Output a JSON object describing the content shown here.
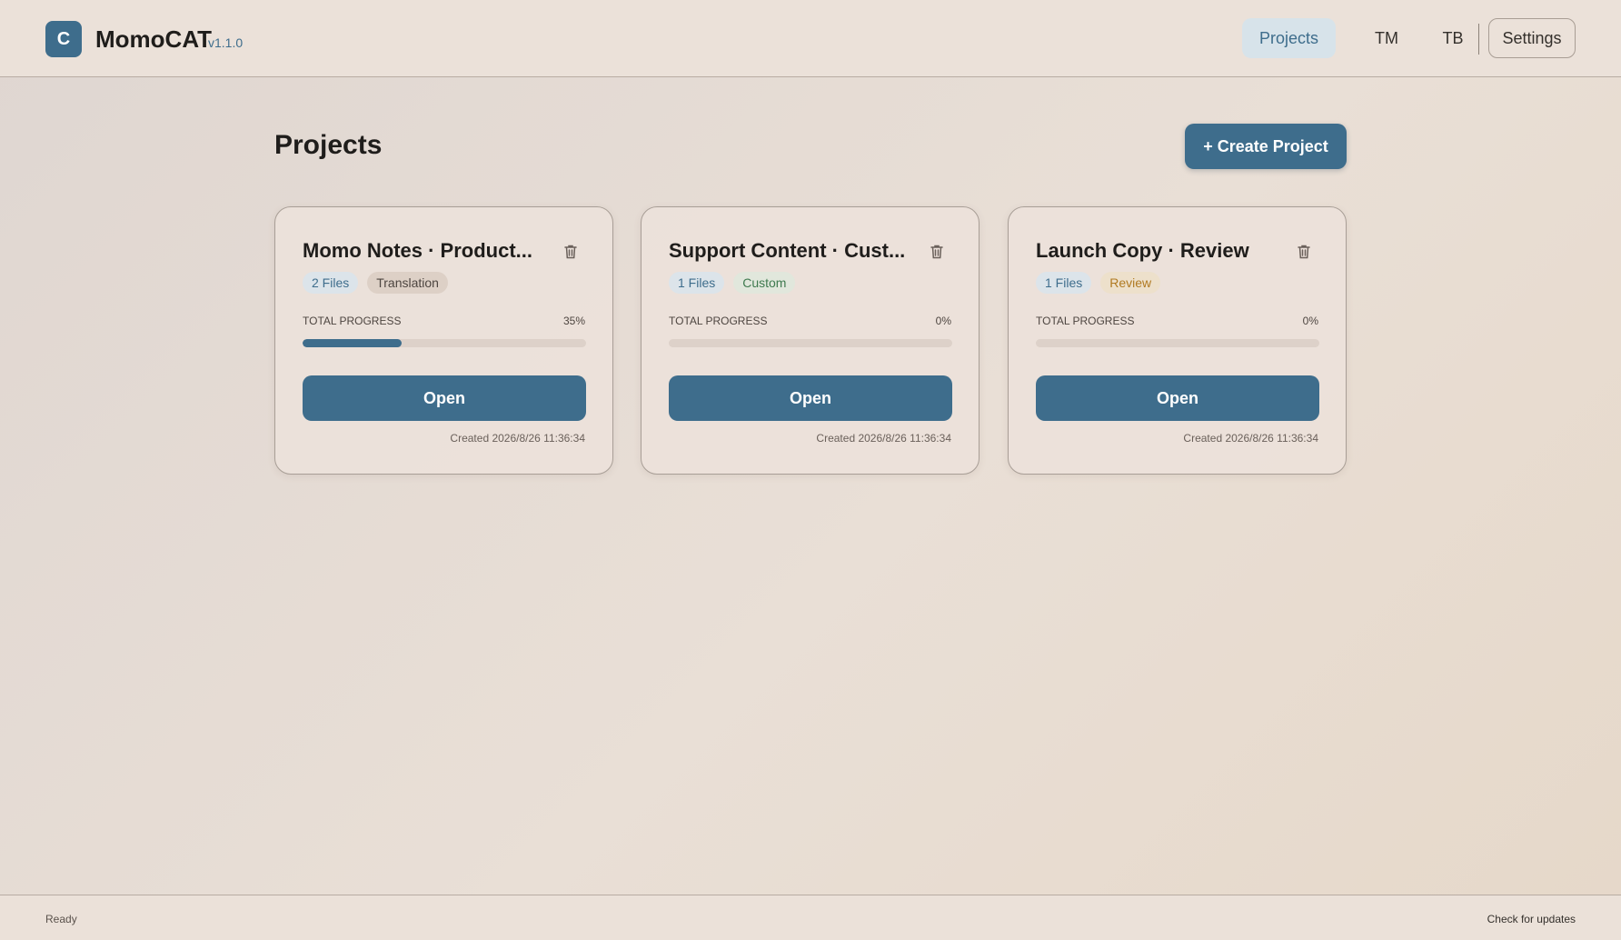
{
  "header": {
    "logo_letter": "C",
    "app_name": "MomoCAT",
    "version": "v1.1.0",
    "nav": {
      "projects": "Projects",
      "tm": "TM",
      "tb": "TB",
      "settings": "Settings"
    },
    "active_nav": "Projects"
  },
  "main": {
    "title": "Projects",
    "create_button": "+ Create Project",
    "progress_label": "TOTAL PROGRESS",
    "open_label": "Open",
    "projects": [
      {
        "title": "Momo Notes · Product...",
        "files": "2 Files",
        "type": "Translation",
        "progress_text": "35%",
        "progress": 0.35,
        "created": "Created 2026/8/26 11:36:34"
      },
      {
        "title": "Support Content · Cust...",
        "files": "1 Files",
        "type": "Custom",
        "progress_text": "0%",
        "progress": 0,
        "created": "Created 2026/8/26 11:36:34"
      },
      {
        "title": "Launch Copy · Review",
        "files": "1 Files",
        "type": "Review",
        "progress_text": "0%",
        "progress": 0,
        "created": "Created 2026/8/26 11:36:34"
      }
    ]
  },
  "footer": {
    "status": "Ready",
    "check_updates": "Check for updates"
  },
  "colors": {
    "accent": "#3e6d8c",
    "translation_badge": "#ddd0c6",
    "custom_badge_text": "#3f7a4f",
    "review_badge_text": "#b07a22"
  },
  "icons": {
    "delete": "trash-icon"
  }
}
